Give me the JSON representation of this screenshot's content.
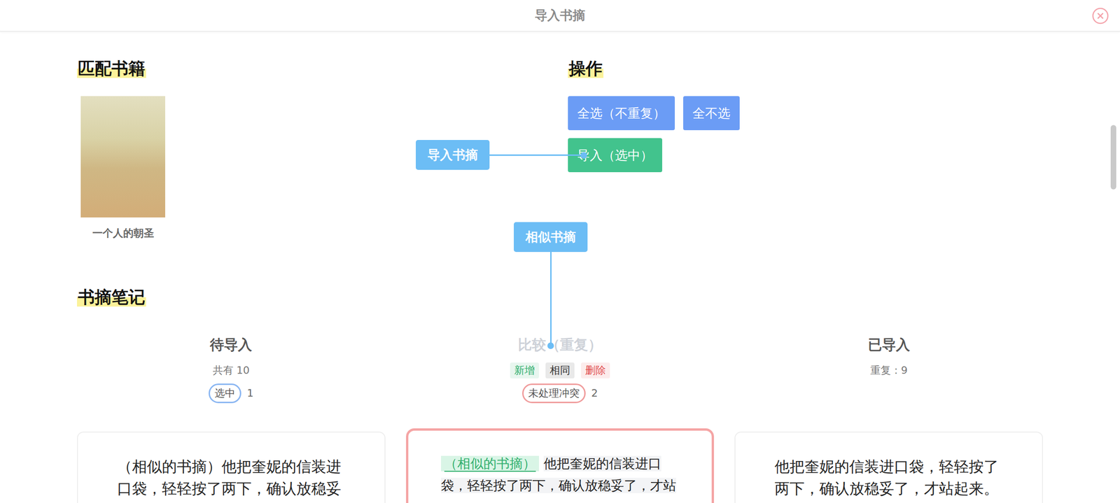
{
  "window": {
    "title": "导入书摘"
  },
  "book_section": {
    "heading": "匹配书籍",
    "book": {
      "title": "一个人的朝圣"
    }
  },
  "actions": {
    "heading": "操作",
    "button_rows": [
      [
        {
          "label": "全选（不重复）",
          "color": "#6b9cf5"
        },
        {
          "label": "全不选",
          "color": "#6b9cf5"
        }
      ],
      [
        {
          "label": "导入（选中）",
          "color": "#42c38d"
        }
      ]
    ]
  },
  "notes": {
    "heading": "书摘笔记",
    "columns": [
      {
        "title": "待导入",
        "dimmed": false,
        "stat": "共有 10",
        "tags": [],
        "pill": {
          "label": "选中",
          "count": "1",
          "color": "#8ab6f2"
        },
        "card": {
          "conflict": false,
          "kind": "text",
          "segments": [
            {
              "text": "（相似的书摘）他把奎妮的信装进口袋，轻轻按了两下，确认放稳妥",
              "kind": "plain"
            }
          ]
        }
      },
      {
        "title": "比较（重复）",
        "dimmed": true,
        "tags": [
          {
            "label": "新增",
            "color": "#2fae6c"
          },
          {
            "label": "相同",
            "color": "#333333"
          },
          {
            "label": "删除",
            "color": "#e14f4f"
          }
        ],
        "pill": {
          "label": "未处理冲突",
          "count": "2",
          "color": "#f09c9c"
        },
        "card": {
          "conflict": true,
          "kind": "diff",
          "segments": [
            {
              "text": "（相似的书摘）",
              "kind": "added"
            },
            {
              "text": "他把奎妮的信装进口袋，轻轻按了两下，确认放稳妥了，才站",
              "kind": "same"
            }
          ]
        }
      },
      {
        "title": "已导入",
        "dimmed": false,
        "stat": "重复：9",
        "tags": [],
        "card": {
          "conflict": false,
          "kind": "text",
          "segments": [
            {
              "text": "他把奎妮的信装进口袋，轻轻按了两下，确认放稳妥了，才站起来。",
              "kind": "plain"
            }
          ]
        }
      }
    ]
  },
  "annotations": [
    {
      "label": "导入书摘",
      "direction": "right"
    },
    {
      "label": "相似书摘",
      "direction": "down"
    }
  ]
}
